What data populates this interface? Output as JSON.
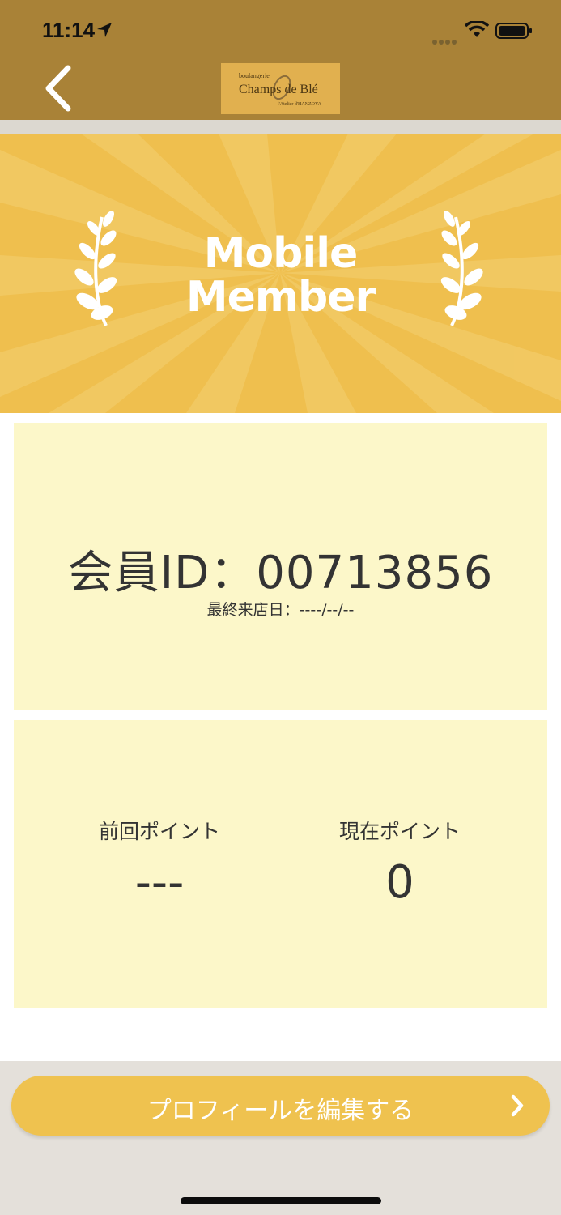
{
  "status_bar": {
    "time": "11:14"
  },
  "header": {
    "logo": {
      "top": "boulangerie",
      "main": "Champs de Blé",
      "sub": "l'Atelier d'HANZOYA"
    }
  },
  "banner": {
    "line1": "Mobile",
    "line2": "Member"
  },
  "member": {
    "id_text": "会員ID：00713856",
    "last_visit": "最終来店日：----/--/--"
  },
  "points": {
    "previous_label": "前回ポイント",
    "previous_value": "---",
    "current_label": "現在ポイント",
    "current_value": "0"
  },
  "actions": {
    "edit_profile_label": "プロフィールを編集する"
  },
  "colors": {
    "nav_bar": "#a98237",
    "banner": "#efbf4e",
    "card": "#fcf7c9",
    "button": "#efc24f"
  },
  "icons": [
    "location-arrow-icon",
    "signal-icon",
    "wifi-icon",
    "battery-icon",
    "back-chevron-icon",
    "laurel-icon",
    "chevron-right-icon"
  ]
}
